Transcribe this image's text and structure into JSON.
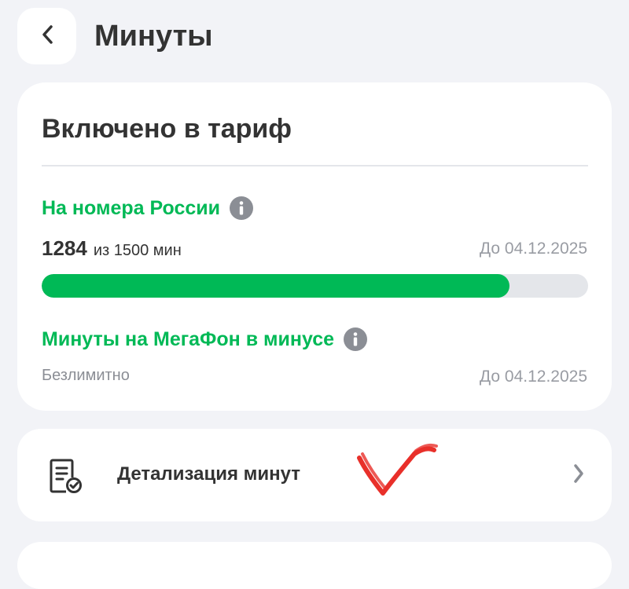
{
  "header": {
    "title": "Минуты"
  },
  "tariff": {
    "title": "Включено в тариф",
    "russia": {
      "label": "На номера России",
      "used": "1284",
      "limit_text": "из 1500 мин",
      "date": "До 04.12.2025",
      "progress_fraction": 0.856
    },
    "megafon": {
      "label": "Минуты на МегаФон в минусе",
      "value": "Безлимитно",
      "date": "До 04.12.2025"
    }
  },
  "details": {
    "label": "Детализация минут"
  },
  "colors": {
    "accent": "#00B956",
    "background": "#F2F3F7",
    "annotation": "#E8302A"
  },
  "icons": {
    "back": "chevron-left-icon",
    "info": "info-icon",
    "document": "document-check-icon",
    "forward": "chevron-right-icon"
  }
}
